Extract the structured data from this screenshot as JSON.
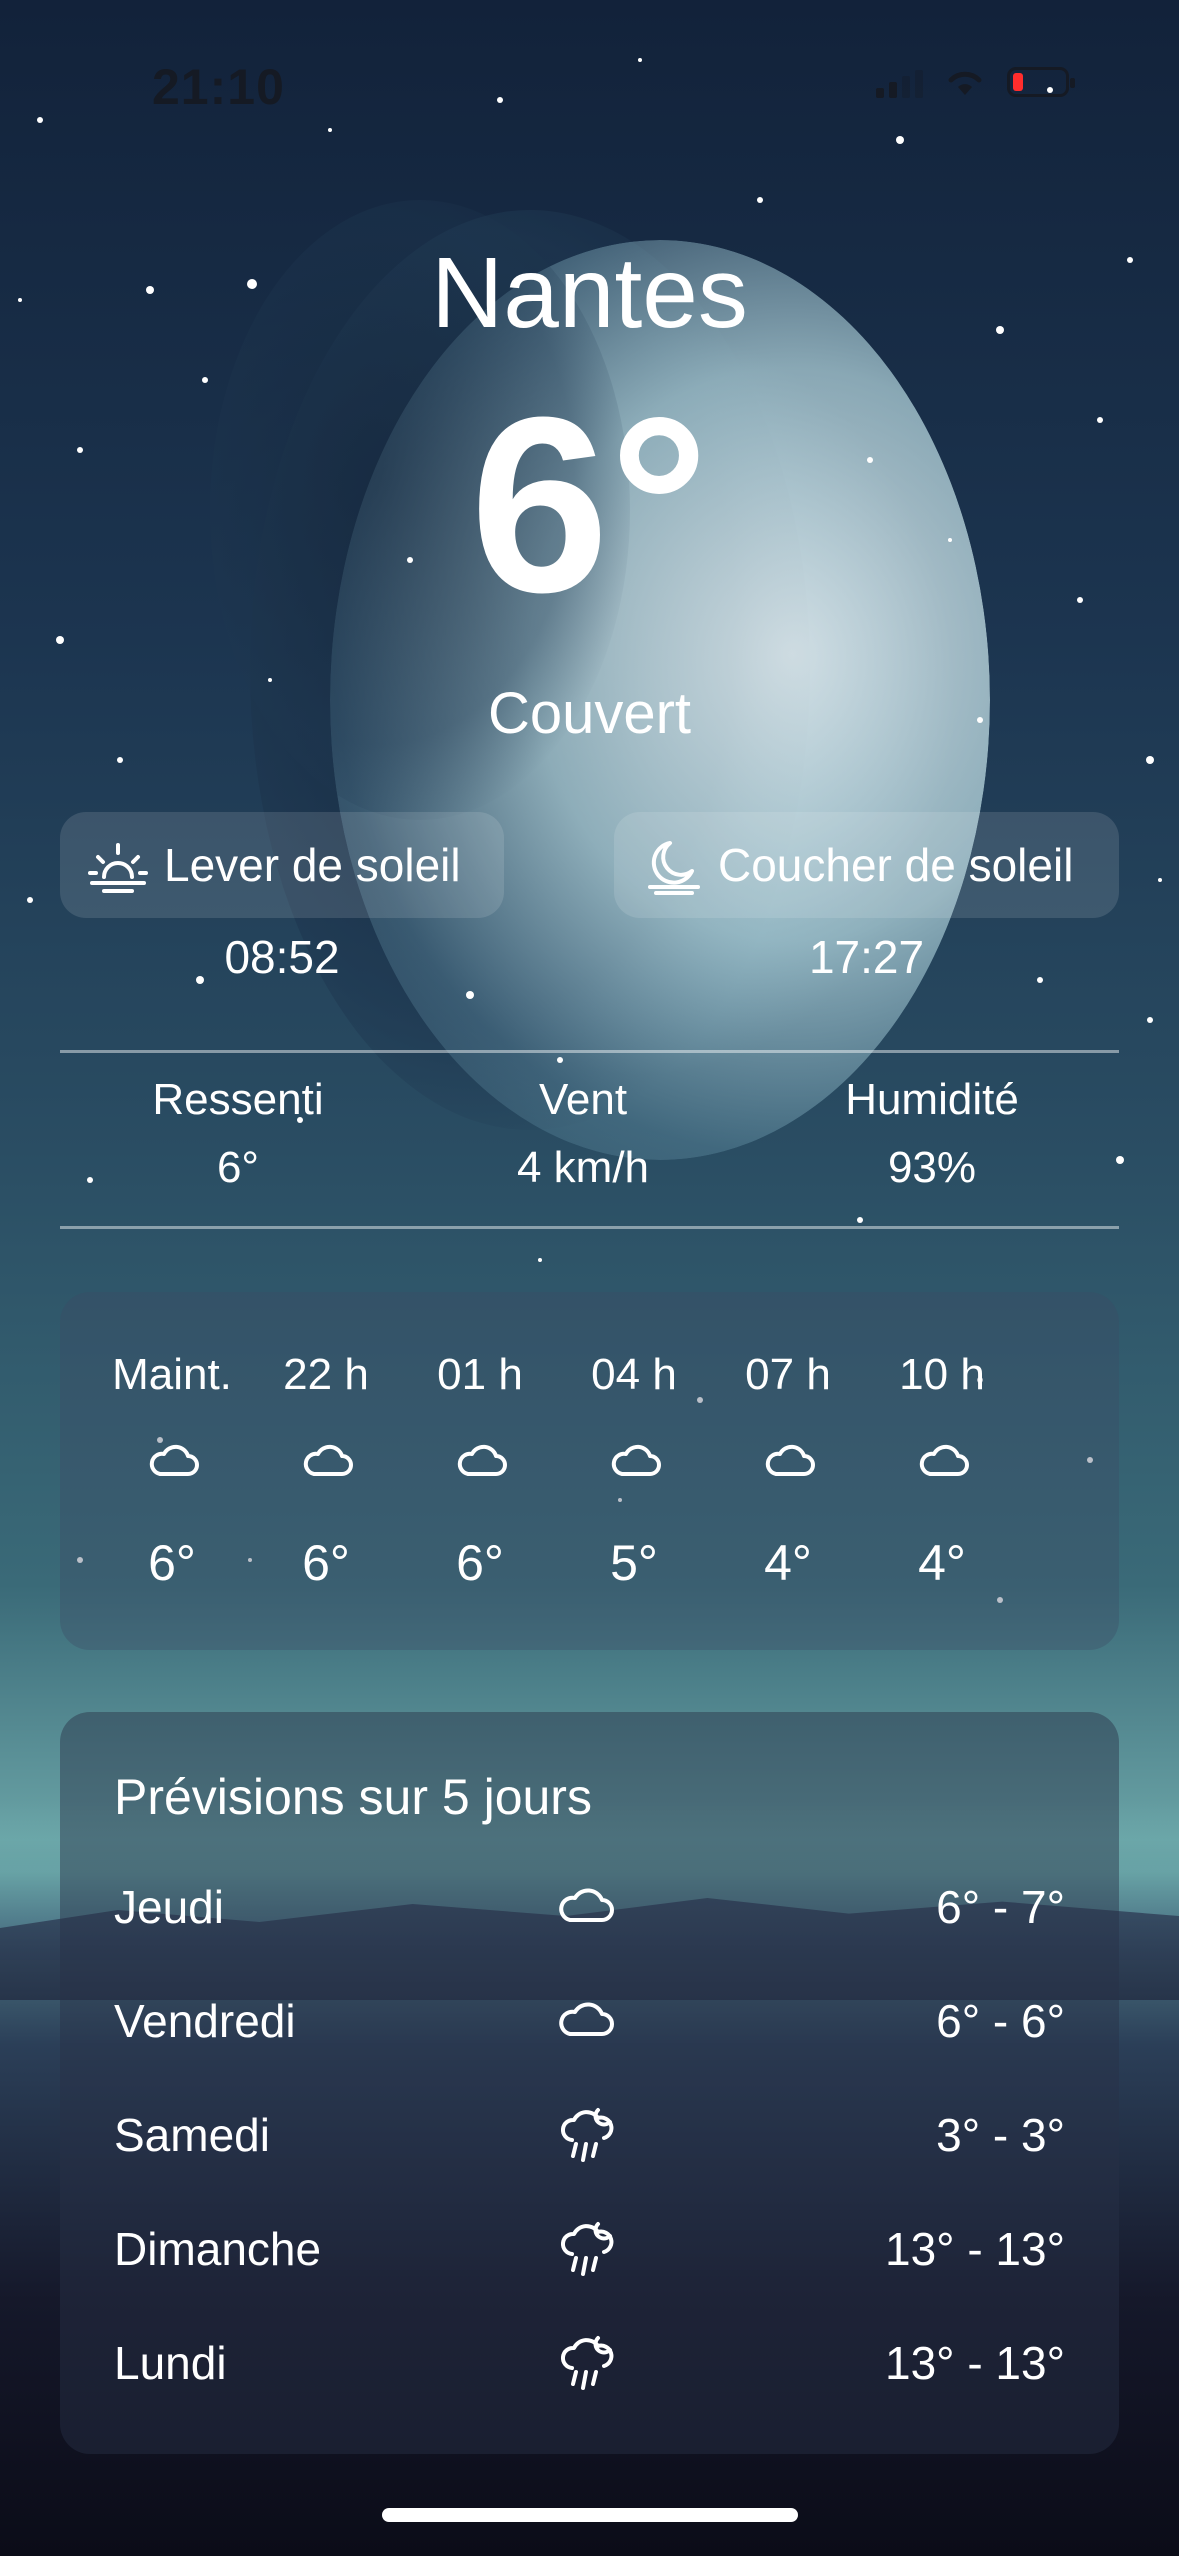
{
  "status_bar": {
    "time": "21:10",
    "battery_color": "#ff2d2d"
  },
  "location": {
    "city": "Nantes"
  },
  "current": {
    "temperature": "6°",
    "condition": "Couvert"
  },
  "sun": {
    "sunrise_label": "Lever de soleil",
    "sunrise_time": "08:52",
    "sunset_label": "Coucher de soleil",
    "sunset_time": "17:27"
  },
  "details": [
    {
      "label": "Ressenti",
      "value": "6°"
    },
    {
      "label": "Vent",
      "value": "4 km/h"
    },
    {
      "label": "Humidité",
      "value": "93%"
    }
  ],
  "hourly": [
    {
      "hour": "Maint.",
      "icon": "cloud-icon",
      "temp": "6°"
    },
    {
      "hour": "22 h",
      "icon": "cloud-icon",
      "temp": "6°"
    },
    {
      "hour": "01 h",
      "icon": "cloud-icon",
      "temp": "6°"
    },
    {
      "hour": "04 h",
      "icon": "cloud-icon",
      "temp": "5°"
    },
    {
      "hour": "07 h",
      "icon": "cloud-icon",
      "temp": "4°"
    },
    {
      "hour": "10 h",
      "icon": "cloud-icon",
      "temp": "4°"
    }
  ],
  "forecast": {
    "title": "Prévisions sur 5 jours",
    "days": [
      {
        "day": "Jeudi",
        "icon": "cloud-icon",
        "range": "6° - 7°"
      },
      {
        "day": "Vendredi",
        "icon": "cloud-icon",
        "range": "6° - 6°"
      },
      {
        "day": "Samedi",
        "icon": "cloud-rain-icon",
        "range": "3° - 3°"
      },
      {
        "day": "Dimanche",
        "icon": "cloud-rain-icon",
        "range": "13° - 13°"
      },
      {
        "day": "Lundi",
        "icon": "cloud-rain-icon",
        "range": "13° - 13°"
      }
    ]
  }
}
